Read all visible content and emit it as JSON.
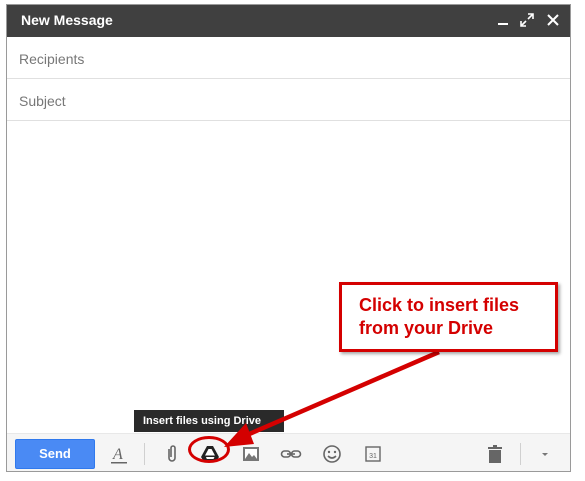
{
  "window": {
    "title": "New Message",
    "controls": [
      "minimize-icon",
      "expand-icon",
      "close-icon"
    ]
  },
  "fields": {
    "recipients_placeholder": "Recipients",
    "subject_placeholder": "Subject"
  },
  "toolbar": {
    "send_label": "Send",
    "icons": [
      "formatting-icon",
      "paperclip-icon",
      "google-drive-icon",
      "image-icon",
      "link-icon",
      "smiley-icon",
      "calendar-icon",
      "trash-icon",
      "more-options-icon"
    ],
    "calendar_day": "31"
  },
  "tooltip": {
    "text": "Insert files using Drive"
  },
  "annotation": {
    "line1": "Click to insert files",
    "line2": "from your Drive",
    "color": "#d40000"
  },
  "colors": {
    "titlebar": "#404040",
    "send_button": "#4a8af4",
    "annotation": "#d40000"
  }
}
